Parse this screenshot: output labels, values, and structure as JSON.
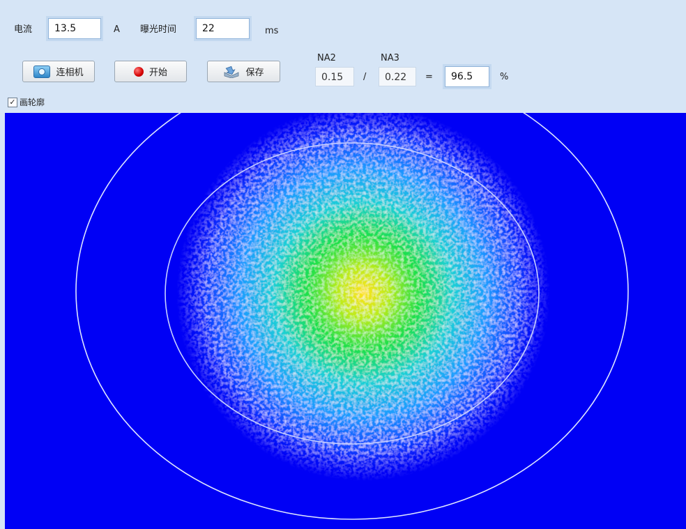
{
  "controls": {
    "current_label": "电流",
    "current_value": "13.5",
    "current_unit": "A",
    "exposure_label": "曝光时间",
    "exposure_value": "22",
    "exposure_unit": "ms"
  },
  "buttons": {
    "connect_label": "连相机",
    "start_label": "开始",
    "save_label": "保存"
  },
  "na": {
    "na2_label": "NA2",
    "na2_value": "0.15",
    "na3_label": "NA3",
    "na3_value": "0.22",
    "divide_symbol": "/",
    "equals_symbol": "=",
    "result_value": "96.5",
    "percent_symbol": "%"
  },
  "options": {
    "draw_contour_label": "画轮廓",
    "draw_contour_checked": true
  },
  "colors": {
    "background_field": "#0000f5",
    "contour_line": "#dde4ff",
    "spot_core": "#ffe020",
    "spot_mid": "#18e04a",
    "spot_outer": "#20c8ff"
  },
  "icons": {
    "connect": "camera-icon",
    "start": "record-icon",
    "save": "save-icon"
  }
}
